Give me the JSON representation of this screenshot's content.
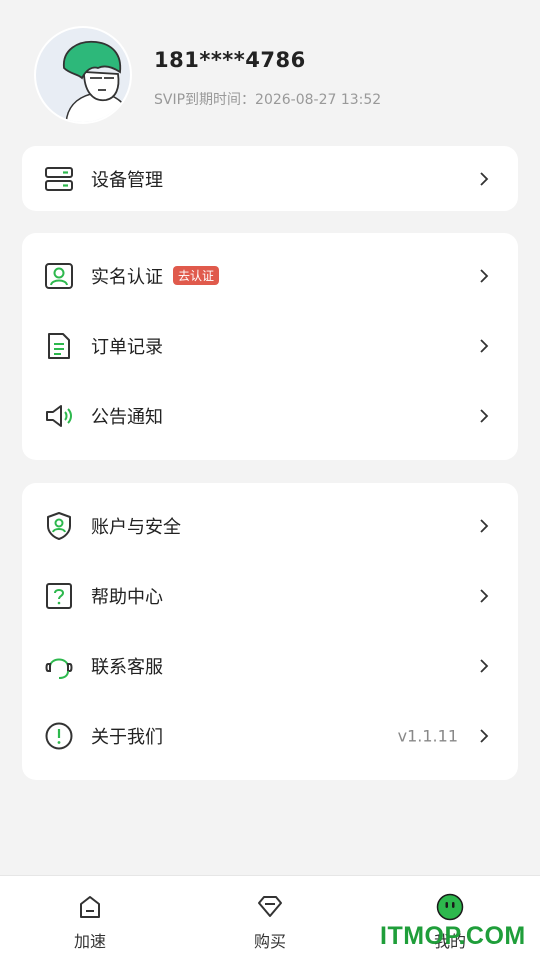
{
  "profile": {
    "phone": "181****4786",
    "expire_label": "SVIP到期时间：",
    "expire_value": "2026-08-27 13:52"
  },
  "group1": [
    {
      "label": "设备管理",
      "icon": "device-icon"
    }
  ],
  "group2": [
    {
      "label": "实名认证",
      "icon": "id-card-icon",
      "badge": "去认证"
    },
    {
      "label": "订单记录",
      "icon": "document-icon"
    },
    {
      "label": "公告通知",
      "icon": "speaker-icon"
    }
  ],
  "group3": [
    {
      "label": "账户与安全",
      "icon": "shield-icon"
    },
    {
      "label": "帮助中心",
      "icon": "help-icon"
    },
    {
      "label": "联系客服",
      "icon": "headset-icon"
    },
    {
      "label": "关于我们",
      "icon": "info-icon",
      "value": "v1.1.11"
    }
  ],
  "tabs": [
    {
      "label": "加速",
      "icon": "home-icon"
    },
    {
      "label": "购买",
      "icon": "diamond-icon"
    },
    {
      "label": "我的",
      "icon": "face-icon",
      "active": true
    }
  ],
  "watermark": "ITMOP.COM",
  "colors": {
    "accent": "#2db84d",
    "badge": "#e05a4c",
    "background": "#f3f3f3"
  }
}
